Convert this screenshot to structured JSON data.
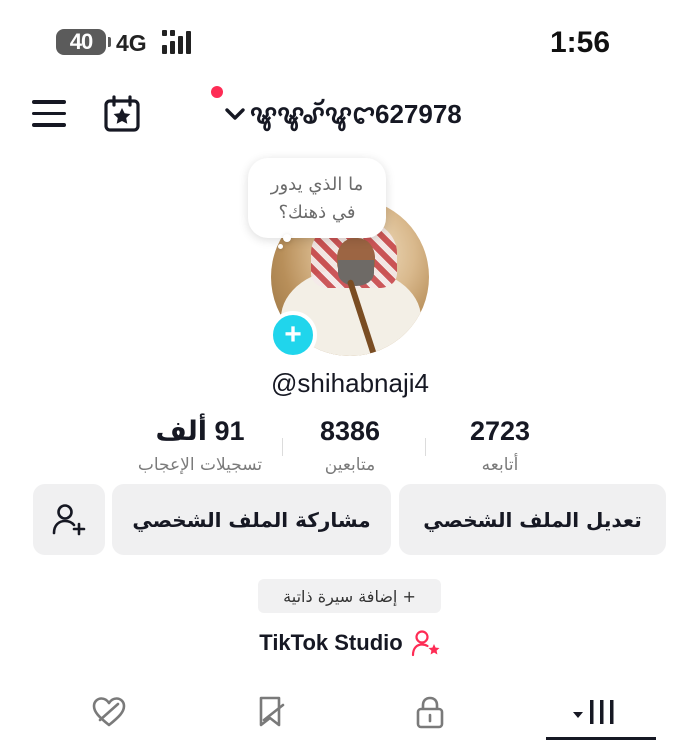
{
  "status_bar": {
    "battery": "40",
    "network": "4G",
    "time": "1:56"
  },
  "header": {
    "username": "ꨡꨡꨣꨮꨥꨤ627978",
    "notification_dot_color": "#fe2c55"
  },
  "profile": {
    "bubble_line1": "ما الذي يدور",
    "bubble_line2": "في ذهنك؟",
    "handle": "@shihabnaji4",
    "accent_color": "#20d5ec"
  },
  "stats": {
    "likes": {
      "value": "91 ألف",
      "label": "تسجيلات الإعجاب"
    },
    "followers": {
      "value": "8386",
      "label": "متابعين"
    },
    "following": {
      "value": "2723",
      "label": "أتابعه"
    }
  },
  "actions": {
    "share_label": "مشاركة الملف الشخصي",
    "edit_label": "تعديل الملف الشخصي",
    "add_bio_label": "+ إضافة سيرة ذاتية",
    "studio_label": "TikTok Studio"
  },
  "tabs": [
    {
      "icon": "liked-heart-icon"
    },
    {
      "icon": "bookmark-icon"
    },
    {
      "icon": "lock-icon"
    },
    {
      "icon": "grid-icon"
    }
  ]
}
